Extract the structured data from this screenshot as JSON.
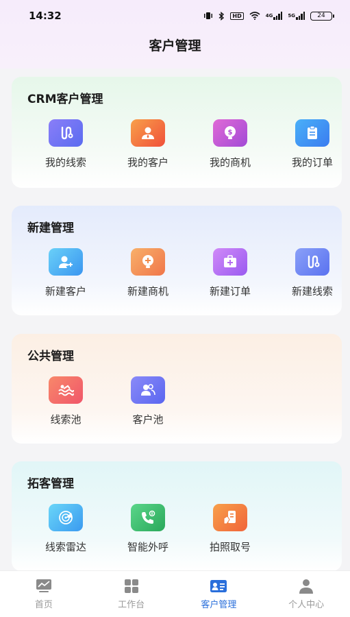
{
  "status": {
    "time": "14:32",
    "battery": "24",
    "hd_label": "HD",
    "net1": "4G",
    "net2": "5G"
  },
  "header": {
    "title": "客户管理"
  },
  "sections": [
    {
      "title": "CRM客户管理",
      "items": [
        {
          "label": "我的线索",
          "icon": "route-icon",
          "color": "#6b6ff0"
        },
        {
          "label": "我的客户",
          "icon": "customer-icon",
          "color": "#f06a3a"
        },
        {
          "label": "我的商机",
          "icon": "money-bulb-icon",
          "color": "#c25cd6"
        },
        {
          "label": "我的订单",
          "icon": "clipboard-icon",
          "color": "#3d8ff0"
        }
      ]
    },
    {
      "title": "新建管理",
      "items": [
        {
          "label": "新建客户",
          "icon": "add-user-icon",
          "color": "#4aa6f0"
        },
        {
          "label": "新建商机",
          "icon": "plus-bulb-icon",
          "color": "#f08a4a"
        },
        {
          "label": "新建订单",
          "icon": "add-case-icon",
          "color": "#b56cf0"
        },
        {
          "label": "新建线索",
          "icon": "route-icon",
          "color": "#6a86f0"
        }
      ]
    },
    {
      "title": "公共管理",
      "items": [
        {
          "label": "线索池",
          "icon": "pool-icon",
          "color": "#f06a6a"
        },
        {
          "label": "客户池",
          "icon": "group-icon",
          "color": "#6a76f0"
        }
      ]
    },
    {
      "title": "拓客管理",
      "items": [
        {
          "label": "线索雷达",
          "icon": "radar-icon",
          "color": "#3ab6f0"
        },
        {
          "label": "智能外呼",
          "icon": "phone-call-icon",
          "color": "#3cc06a"
        },
        {
          "label": "拍照取号",
          "icon": "photo-number-icon",
          "color": "#f07a3a"
        }
      ]
    }
  ],
  "tabs": [
    {
      "label": "首页",
      "icon": "home-chart-icon",
      "active": false
    },
    {
      "label": "工作台",
      "icon": "grid-icon",
      "active": false
    },
    {
      "label": "客户管理",
      "icon": "id-card-icon",
      "active": true
    },
    {
      "label": "个人中心",
      "icon": "person-icon",
      "active": false
    }
  ],
  "colors": {
    "accent": "#2a6fdb",
    "inactive": "#9a9a9a"
  }
}
